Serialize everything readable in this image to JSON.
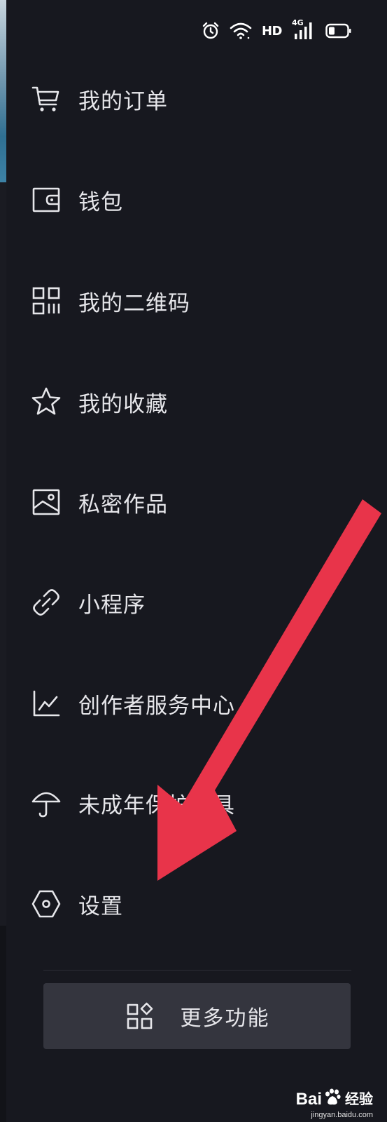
{
  "status_bar": {
    "network_label": "HD",
    "cellular_label": "4G",
    "icons": [
      "alarm-icon",
      "wifi-icon",
      "cellular-signal-icon",
      "battery-icon"
    ]
  },
  "menu": {
    "items": [
      {
        "label": "我的订单",
        "icon": "shopping-cart-icon"
      },
      {
        "label": "钱包",
        "icon": "wallet-icon"
      },
      {
        "label": "我的二维码",
        "icon": "qr-code-icon"
      },
      {
        "label": "我的收藏",
        "icon": "star-icon"
      },
      {
        "label": "私密作品",
        "icon": "image-icon"
      },
      {
        "label": "小程序",
        "icon": "link-icon"
      },
      {
        "label": "创作者服务中心",
        "icon": "chart-icon"
      },
      {
        "label": "未成年保护工具",
        "icon": "umbrella-icon"
      },
      {
        "label": "设置",
        "icon": "settings-hexagon-icon"
      }
    ]
  },
  "more_button": {
    "label": "更多功能",
    "icon": "grid-apps-icon"
  },
  "annotation": {
    "arrow_color": "#e8344a"
  },
  "watermark": {
    "logo_bai": "Bai",
    "logo_du": "du",
    "logo_jingyan": "经验",
    "url": "jingyan.baidu.com"
  },
  "colors": {
    "background": "#17181f",
    "text": "#e6e6ea",
    "button_bg": "#34353e",
    "arrow": "#e8344a"
  }
}
